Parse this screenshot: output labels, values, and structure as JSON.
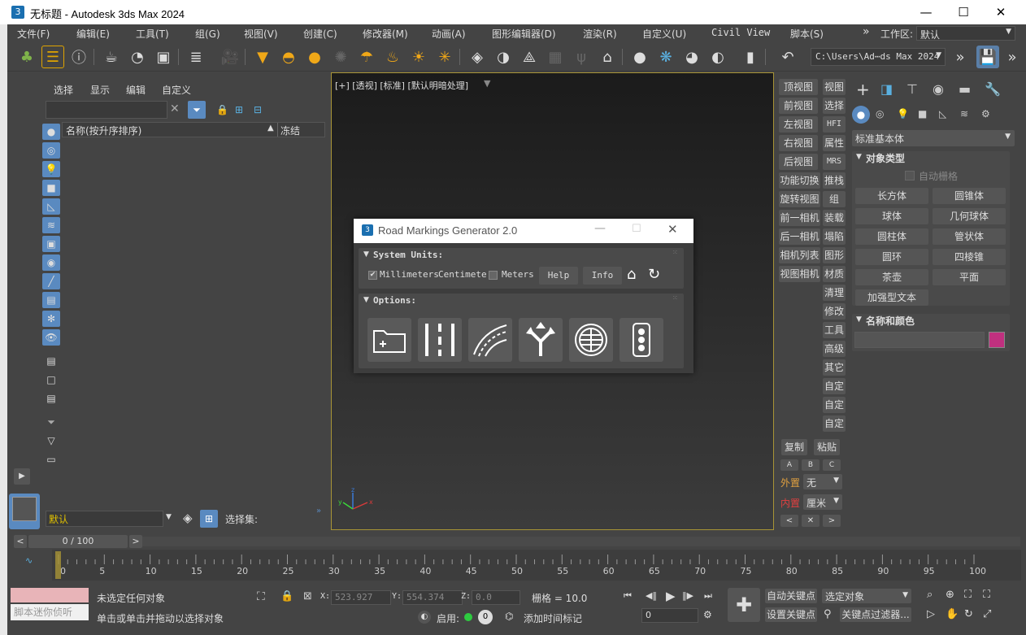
{
  "window": {
    "title": "无标题 - Autodesk 3ds Max 2024",
    "app_icon": "3"
  },
  "menubar": {
    "items": [
      "文件(F)",
      "编辑(E)",
      "工具(T)",
      "组(G)",
      "视图(V)",
      "创建(C)",
      "修改器(M)",
      "动画(A)",
      "图形编辑器(D)",
      "渲染(R)",
      "自定义(U)",
      "Civil View",
      "脚本(S)"
    ],
    "overflow": "»",
    "workspace_label": "工作区:",
    "workspace_value": "默认"
  },
  "toolbar": {
    "path": "C:\\Users\\Ad⋯ds Max 2024"
  },
  "scene_explorer": {
    "menu": [
      "选择",
      "显示",
      "编辑",
      "自定义"
    ],
    "col_name": "名称(按升序排序)",
    "col_frozen": "冻结",
    "layer": "默认",
    "selection_set": "选择集:"
  },
  "viewport": {
    "label": "[+] [透视] [标准] [默认明暗处理]"
  },
  "viewport_buttons": {
    "left": [
      "顶视图",
      "前视图",
      "左视图",
      "右视图",
      "后视图",
      "功能切换",
      "旋转视图",
      "前一相机",
      "后一相机",
      "相机列表",
      "视图相机"
    ],
    "right": [
      "视图",
      "选择",
      "HFI",
      "属性",
      "MRS",
      "推栈",
      "组",
      "装载",
      "塌陷",
      "图形",
      "材质",
      "清理",
      "修改",
      "工具",
      "高级",
      "其它",
      "自定",
      "自定",
      "自定"
    ],
    "copy": "复制",
    "paste": "粘贴",
    "abc": [
      "A",
      "B",
      "C"
    ],
    "outer_label": "外置",
    "outer_value": "无",
    "inner_label": "内置",
    "inner_value": "厘米"
  },
  "command_panel": {
    "category": "标准基本体",
    "object_type": "对象类型",
    "autogrid": "自动栅格",
    "objects": [
      "长方体",
      "圆锥体",
      "球体",
      "几何球体",
      "圆柱体",
      "管状体",
      "圆环",
      "四棱锥",
      "茶壶",
      "平面",
      "加强型文本"
    ],
    "name_color": "名称和颜色",
    "color": "#c0307f"
  },
  "dialog": {
    "title": "Road Markings Generator 2.0",
    "system_units": "System Units:",
    "millimeters": "Millimeters",
    "centimeter": "Centimeter",
    "meters": "Meters",
    "help": "Help",
    "info": "Info",
    "options": "Options:"
  },
  "timeline": {
    "frame": "0 / 100",
    "ticks": [
      "0",
      "5",
      "10",
      "15",
      "20",
      "25",
      "30",
      "35",
      "40",
      "45",
      "50",
      "55",
      "60",
      "65",
      "70",
      "75",
      "80",
      "85",
      "90",
      "95",
      "100"
    ]
  },
  "status": {
    "script_placeholder": "脚本迷你侦听",
    "no_selection": "未选定任何对象",
    "prompt": "单击或单击并拖动以选择对象",
    "x_label": "X:",
    "x": "523.927",
    "y_label": "Y:",
    "y": "554.374",
    "z_label": "Z:",
    "z": "0.0",
    "grid": "栅格 = 10.0",
    "enable": "启用:",
    "add_time_tag": "添加时间标记",
    "auto_key": "自动关键点",
    "selected": "选定对象",
    "set_key": "设置关键点",
    "key_filters": "关键点过滤器...",
    "frame_value": "0"
  }
}
